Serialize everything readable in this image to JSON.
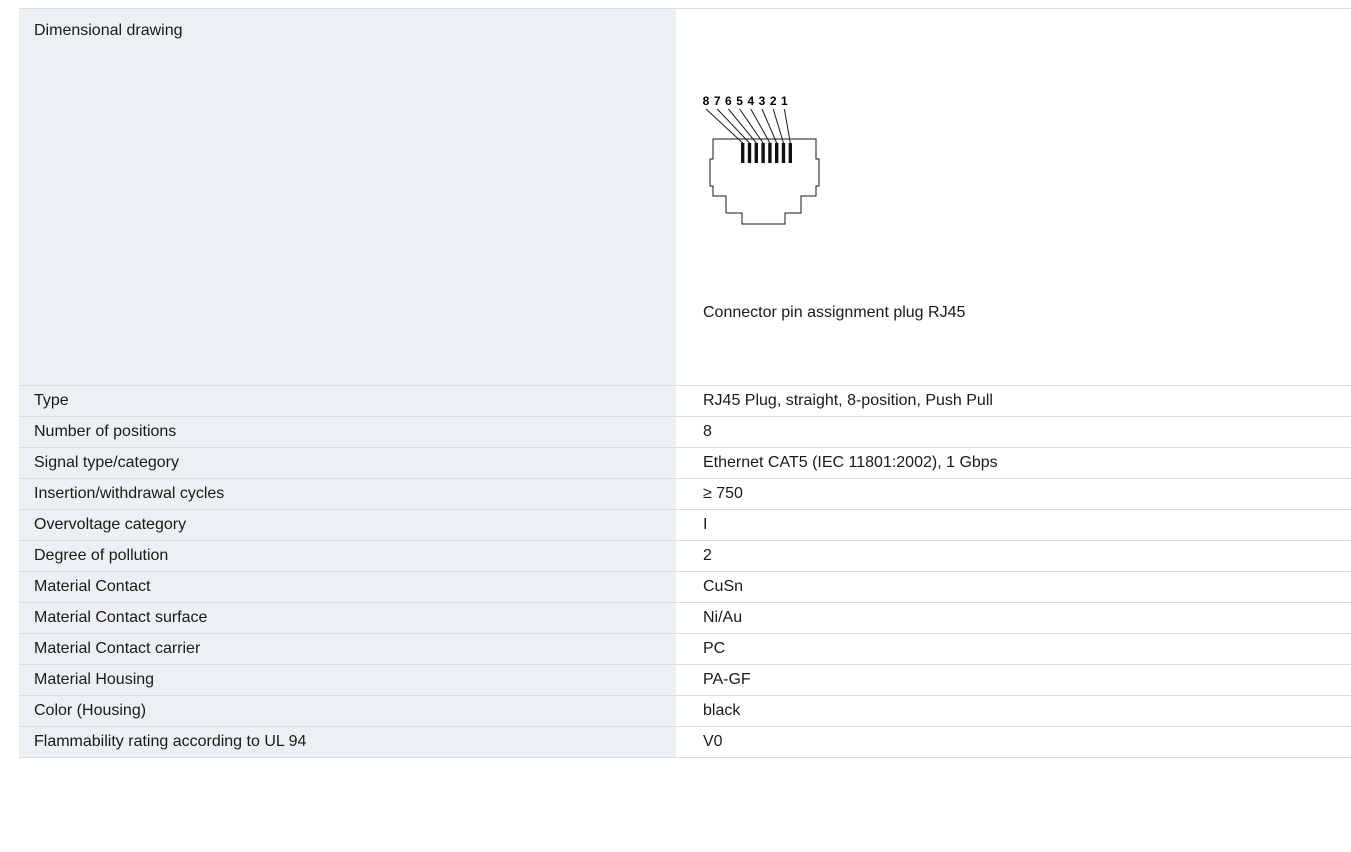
{
  "drawing": {
    "label": "Dimensional drawing",
    "caption": "Connector pin assignment plug RJ45",
    "pin_numbers": [
      "8",
      "7",
      "6",
      "5",
      "4",
      "3",
      "2",
      "1"
    ]
  },
  "specs": [
    {
      "label": "Type",
      "value": "RJ45 Plug, straight, 8-position, Push Pull"
    },
    {
      "label": "Number of positions",
      "value": "8"
    },
    {
      "label": "Signal type/category",
      "value": "Ethernet CAT5 (IEC 11801:2002), 1 Gbps"
    },
    {
      "label": "Insertion/withdrawal cycles",
      "value": "≥ 750"
    },
    {
      "label": "Overvoltage category",
      "value": "I"
    },
    {
      "label": "Degree of pollution",
      "value": "2"
    },
    {
      "label": "Material Contact",
      "value": "CuSn"
    },
    {
      "label": "Material Contact surface",
      "value": "Ni/Au"
    },
    {
      "label": "Material Contact carrier",
      "value": "PC"
    },
    {
      "label": "Material Housing",
      "value": "PA-GF"
    },
    {
      "label": "Color (Housing)",
      "value": "black"
    },
    {
      "label": "Flammability rating according to UL 94",
      "value": "V0"
    }
  ]
}
